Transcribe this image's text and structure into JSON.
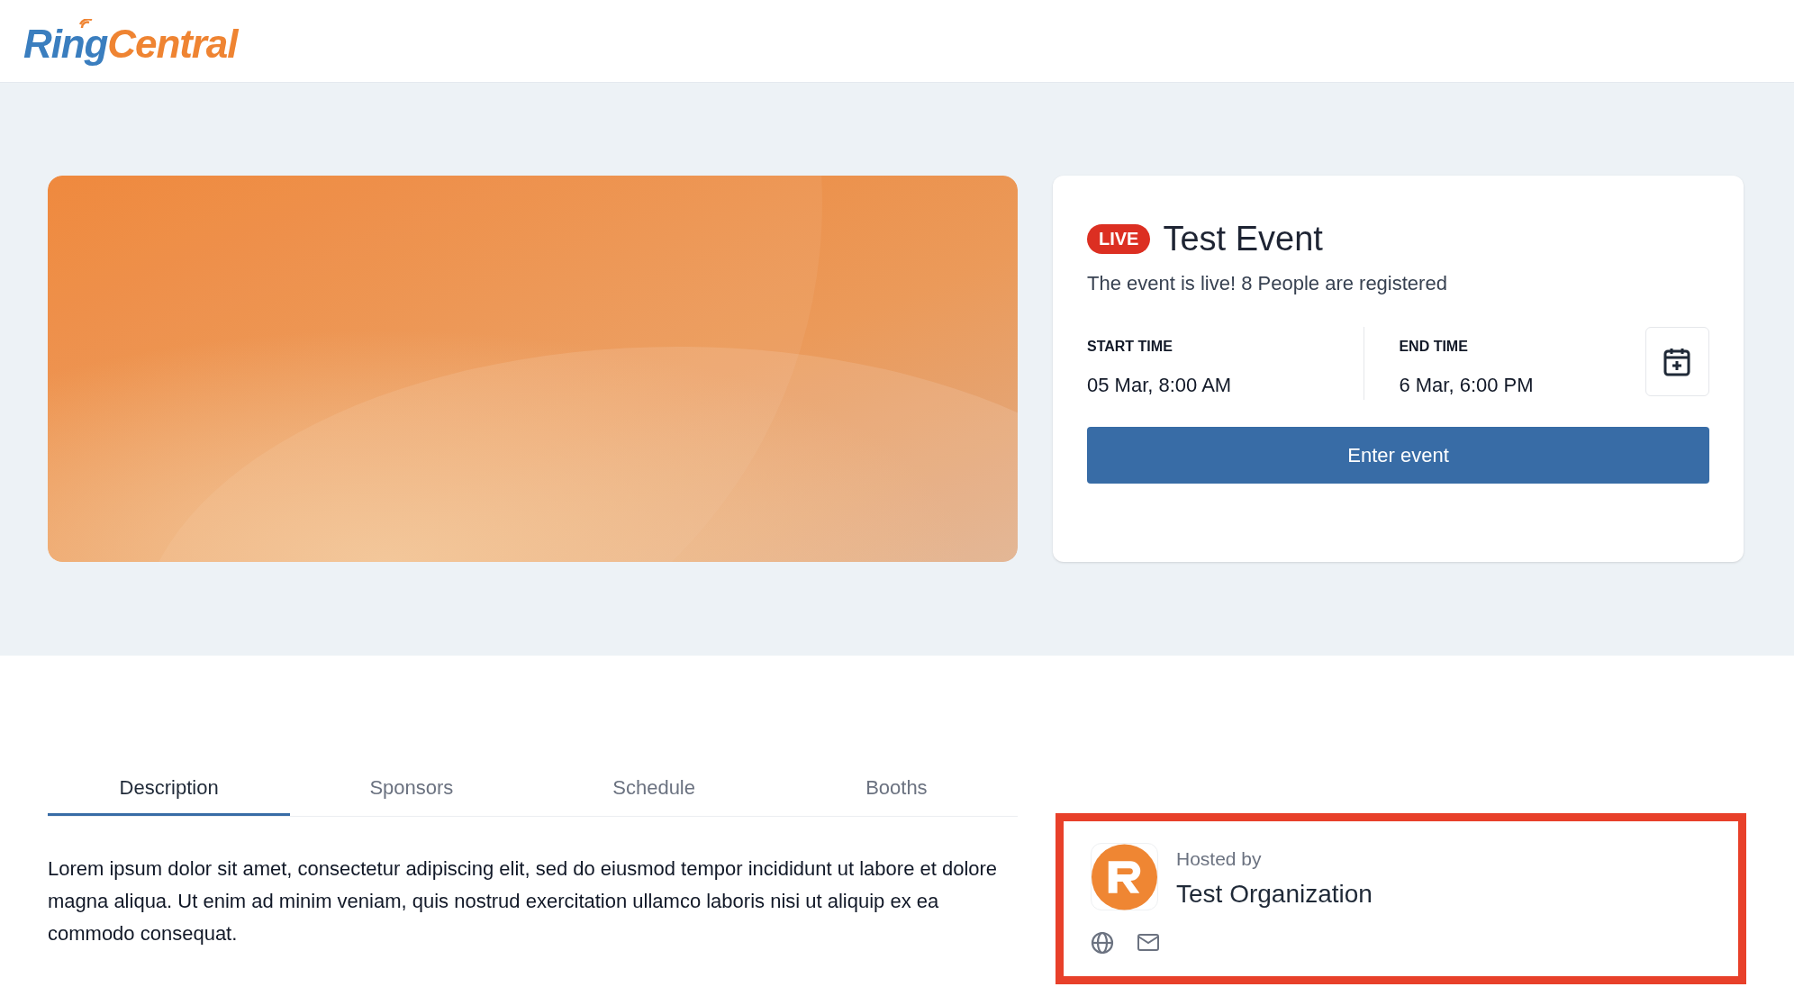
{
  "logo": {
    "first": "Ring",
    "second": "Central"
  },
  "event": {
    "badge": "LIVE",
    "title": "Test Event",
    "subtitle": "The event is live! 8 People are registered",
    "times": [
      {
        "label": "START TIME",
        "value": "05 Mar, 8:00 AM"
      },
      {
        "label": "END TIME",
        "value": "6 Mar, 6:00 PM"
      }
    ],
    "button": "Enter event"
  },
  "tabs": [
    {
      "label": "Description",
      "selected": true
    },
    {
      "label": "Sponsors",
      "selected": false
    },
    {
      "label": "Schedule",
      "selected": false
    },
    {
      "label": "Booths",
      "selected": false
    }
  ],
  "description": "Lorem ipsum dolor sit amet, consectetur adipiscing elit, sed do eiusmod tempor incididunt ut labore et dolore magna aliqua. Ut enim ad minim veniam, quis nostrud exercitation ullamco laboris nisi ut aliquip ex ea commodo consequat.",
  "host": {
    "caption": "Hosted by",
    "name": "Test Organization",
    "highlighted": true
  }
}
